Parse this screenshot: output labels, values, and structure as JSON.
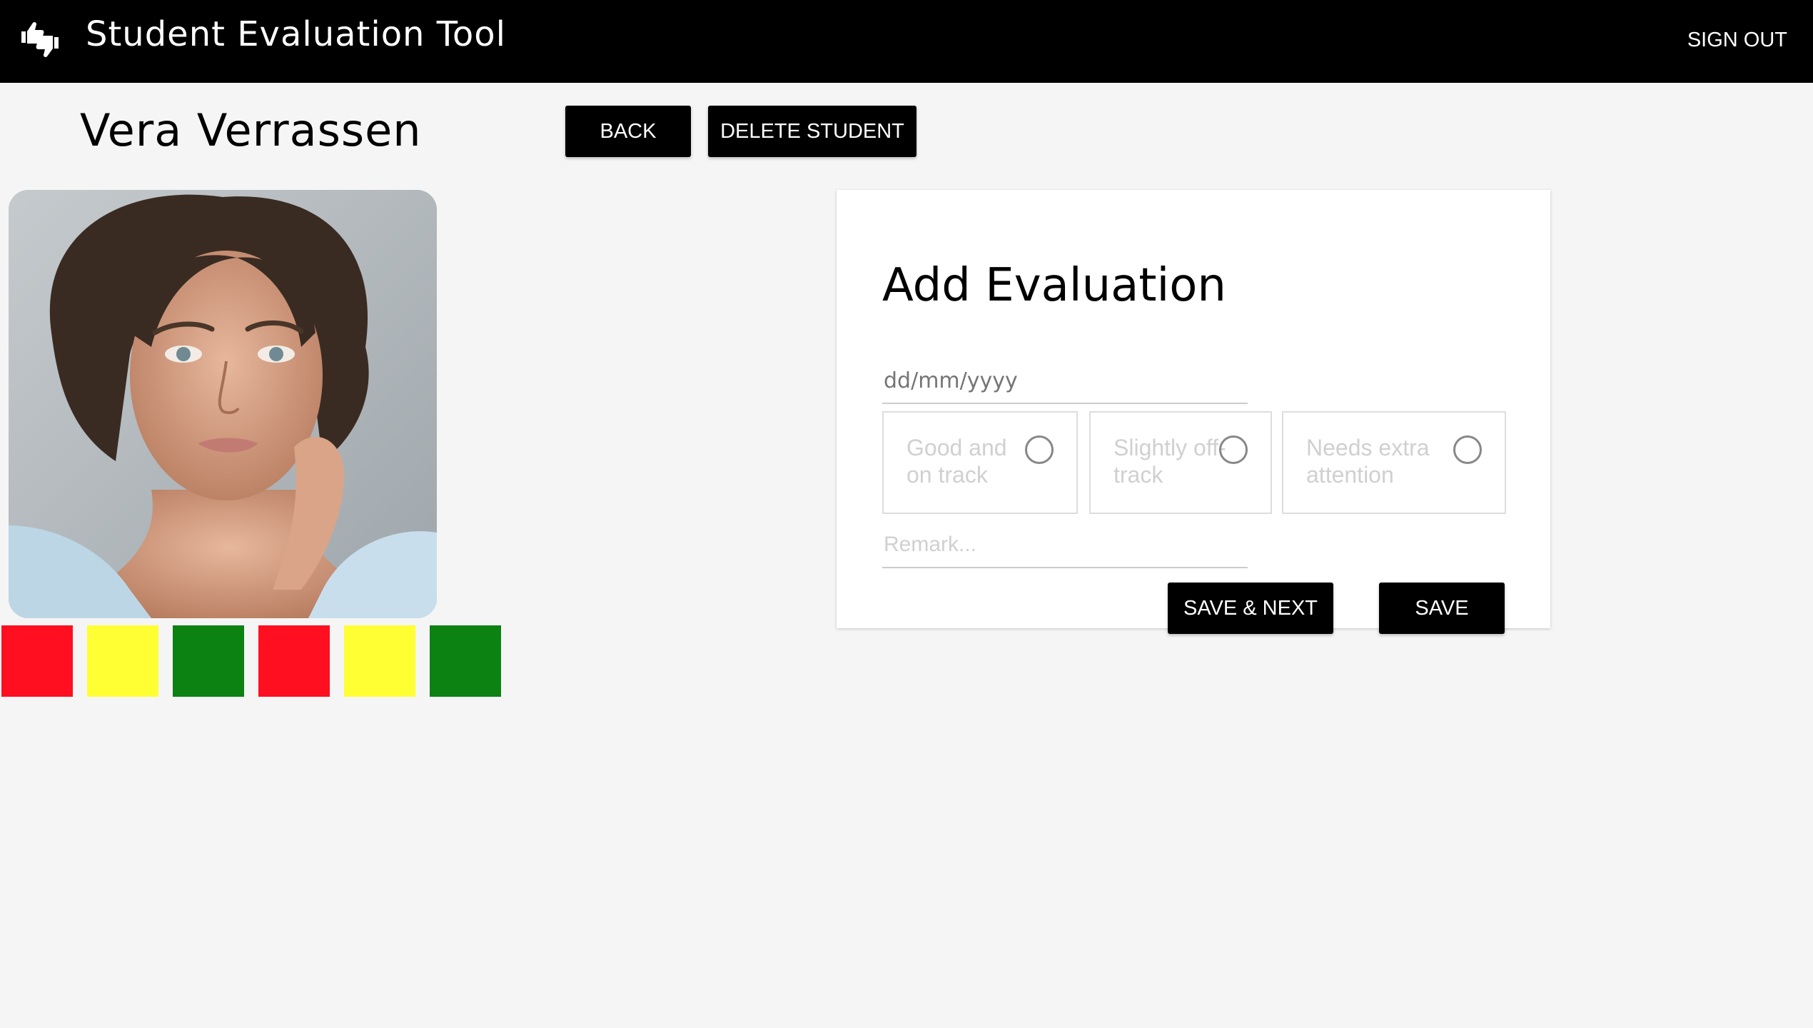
{
  "app": {
    "title": "Student Evaluation Tool",
    "sign_out_label": "SIGN OUT",
    "logo_icon": "thumbs-up-down-icon"
  },
  "student": {
    "name": "Vera Verrassen",
    "back_label": "BACK",
    "delete_label": "DELETE STUDENT",
    "photo_icon": "student-photo"
  },
  "history": [
    {
      "color": "#ff0f1f"
    },
    {
      "color": "#ffff33"
    },
    {
      "color": "#0c8212"
    },
    {
      "color": "#ff0f1f"
    },
    {
      "color": "#ffff33"
    },
    {
      "color": "#0c8212"
    }
  ],
  "evaluation_form": {
    "title": "Add Evaluation",
    "date_placeholder": "dd/mm/yyyy",
    "options": [
      {
        "label": "Good and on track",
        "selected": false
      },
      {
        "label": "Slightly off-track",
        "selected": false
      },
      {
        "label": "Needs extra attention",
        "selected": false
      }
    ],
    "remark_placeholder": "Remark...",
    "save_next_label": "SAVE & NEXT",
    "save_label": "SAVE"
  }
}
